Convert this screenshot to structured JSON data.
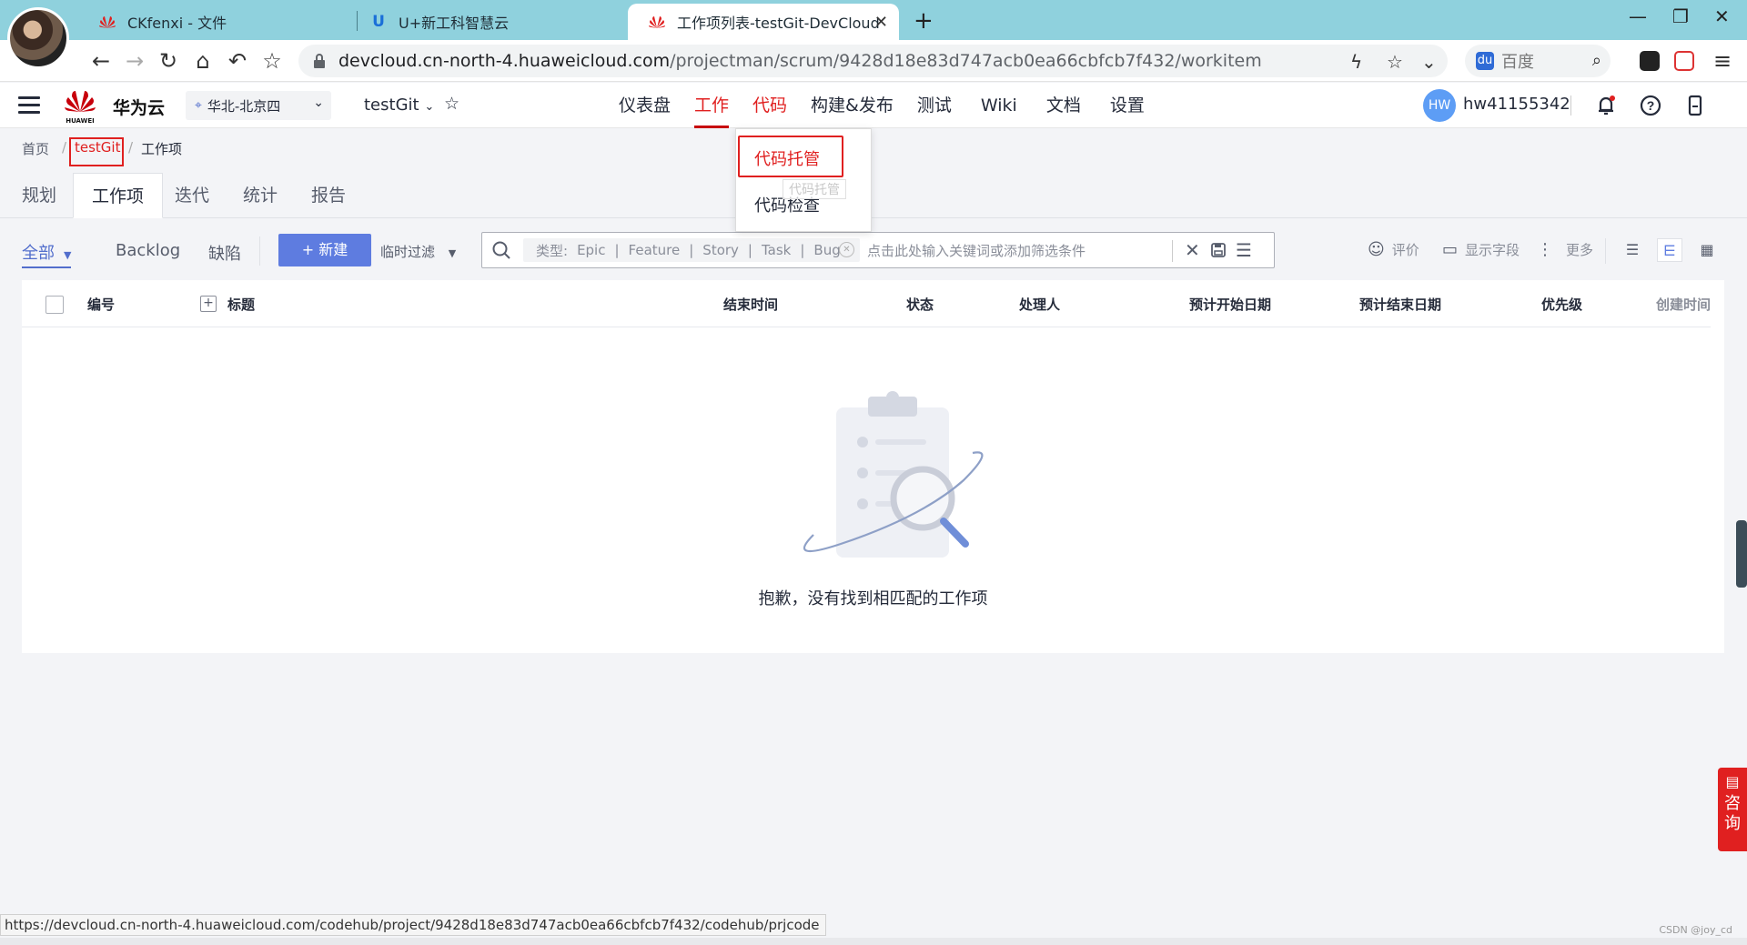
{
  "browser": {
    "tabs": [
      {
        "title": "CKfenxi - 文件"
      },
      {
        "title": "U+新工科智慧云"
      },
      {
        "title": "工作项列表-testGit-DevCloud"
      }
    ],
    "url_host": "devcloud.cn-north-4.huaweicloud.com",
    "url_path": "/projectman/scrum/9428d18e83d747acb0ea66cbfcb7f432/workitem",
    "search_engine": "百度",
    "status_url": "https://devcloud.cn-north-4.huaweicloud.com/codehub/project/9428d18e83d747acb0ea66cbfcb7f432/codehub/prjcode"
  },
  "header": {
    "logo_text": "HUAWEI",
    "brand": "华为云",
    "region": "华北-北京四",
    "project": "testGit",
    "nav": [
      {
        "label": "仪表盘"
      },
      {
        "label": "工作"
      },
      {
        "label": "代码"
      },
      {
        "label": "构建&发布"
      },
      {
        "label": "测试"
      },
      {
        "label": "Wiki"
      },
      {
        "label": "文档"
      },
      {
        "label": "设置"
      }
    ],
    "avatar_initials": "HW",
    "username": "hw41155342"
  },
  "dropdown": {
    "items": [
      {
        "label": "代码托管"
      },
      {
        "label": "代码检查"
      }
    ],
    "tooltip": "代码托管"
  },
  "breadcrumb": {
    "home": "首页",
    "project": "testGit",
    "current": "工作项"
  },
  "subtabs": [
    {
      "label": "规划"
    },
    {
      "label": "工作项"
    },
    {
      "label": "迭代"
    },
    {
      "label": "统计"
    },
    {
      "label": "报告"
    }
  ],
  "toolbar": {
    "all": "全部",
    "backlog": "Backlog",
    "bug": "缺陷",
    "new_button": "+ 新建",
    "temp_filter": "临时过滤",
    "filter_type_label": "类型:",
    "filter_types": [
      "Epic",
      "Feature",
      "Story",
      "Task",
      "Bug"
    ],
    "filter_placeholder": "点击此处输入关键词或添加筛选条件",
    "rate": "评价",
    "show_fields": "显示字段",
    "more": "更多"
  },
  "table": {
    "columns": [
      "编号",
      "标题",
      "结束时间",
      "状态",
      "处理人",
      "预计开始日期",
      "预计结束日期",
      "优先级",
      "创建时间"
    ],
    "empty_text": "抱歉，没有找到相匹配的工作项"
  },
  "consult": {
    "label_1": "咨",
    "label_2": "询"
  },
  "watermark": "CSDN @joy_cd",
  "colors": {
    "brand_red": "#c7000b",
    "primary_blue": "#5e7ce0",
    "tabstrip": "#8fd1dd"
  }
}
